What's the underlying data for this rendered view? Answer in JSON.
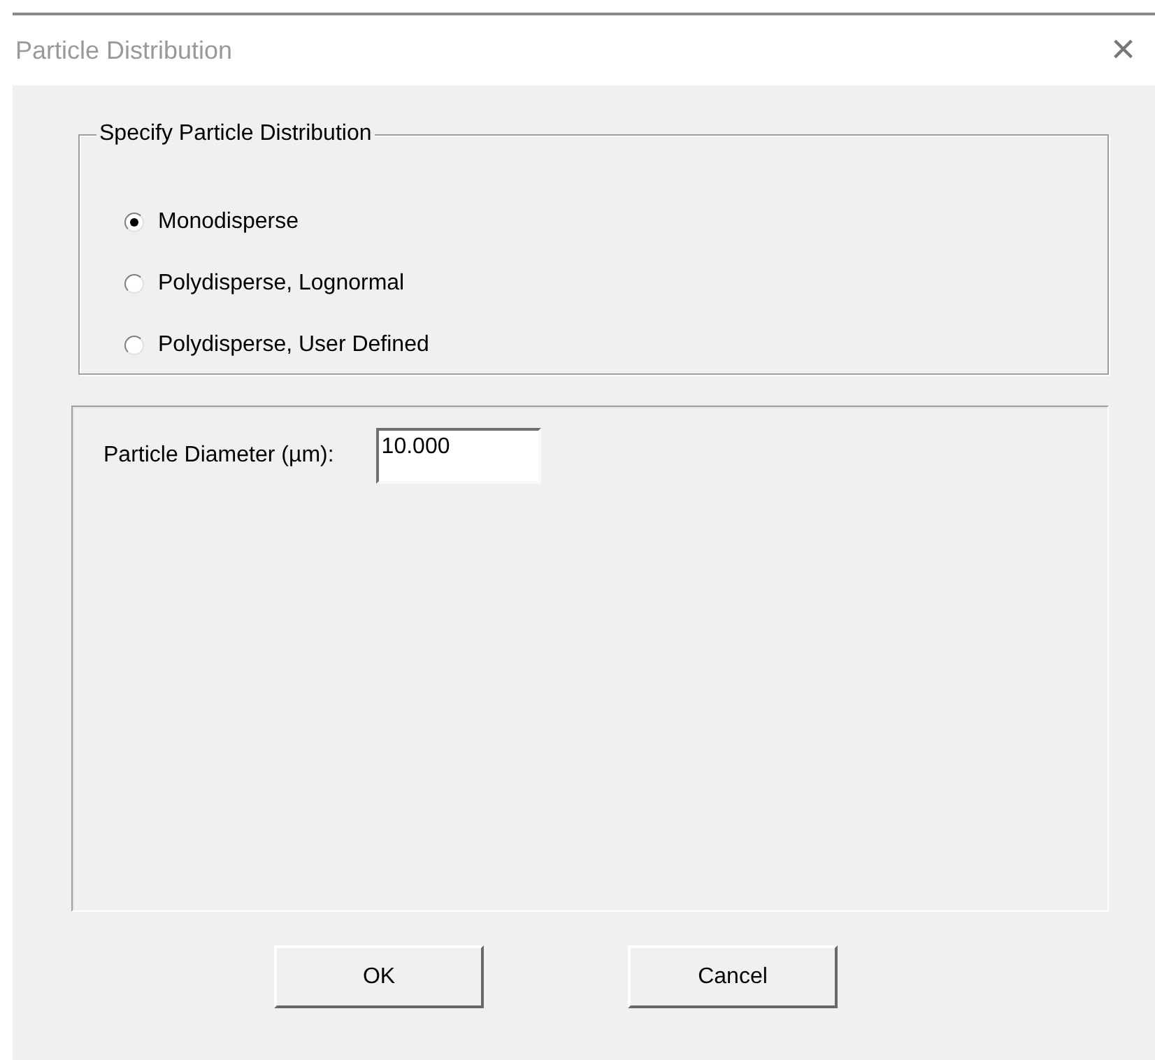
{
  "window": {
    "title": "Particle Distribution",
    "close": "×"
  },
  "distribution_group": {
    "legend": "Specify Particle Distribution",
    "options": [
      {
        "label": "Monodisperse",
        "selected": true
      },
      {
        "label": "Polydisperse, Lognormal",
        "selected": false
      },
      {
        "label": "Polydisperse, User Defined",
        "selected": false
      }
    ]
  },
  "parameters": {
    "label": "Particle Diameter (µm):",
    "value": "10.000"
  },
  "buttons": [
    "OK",
    "Cancel"
  ]
}
